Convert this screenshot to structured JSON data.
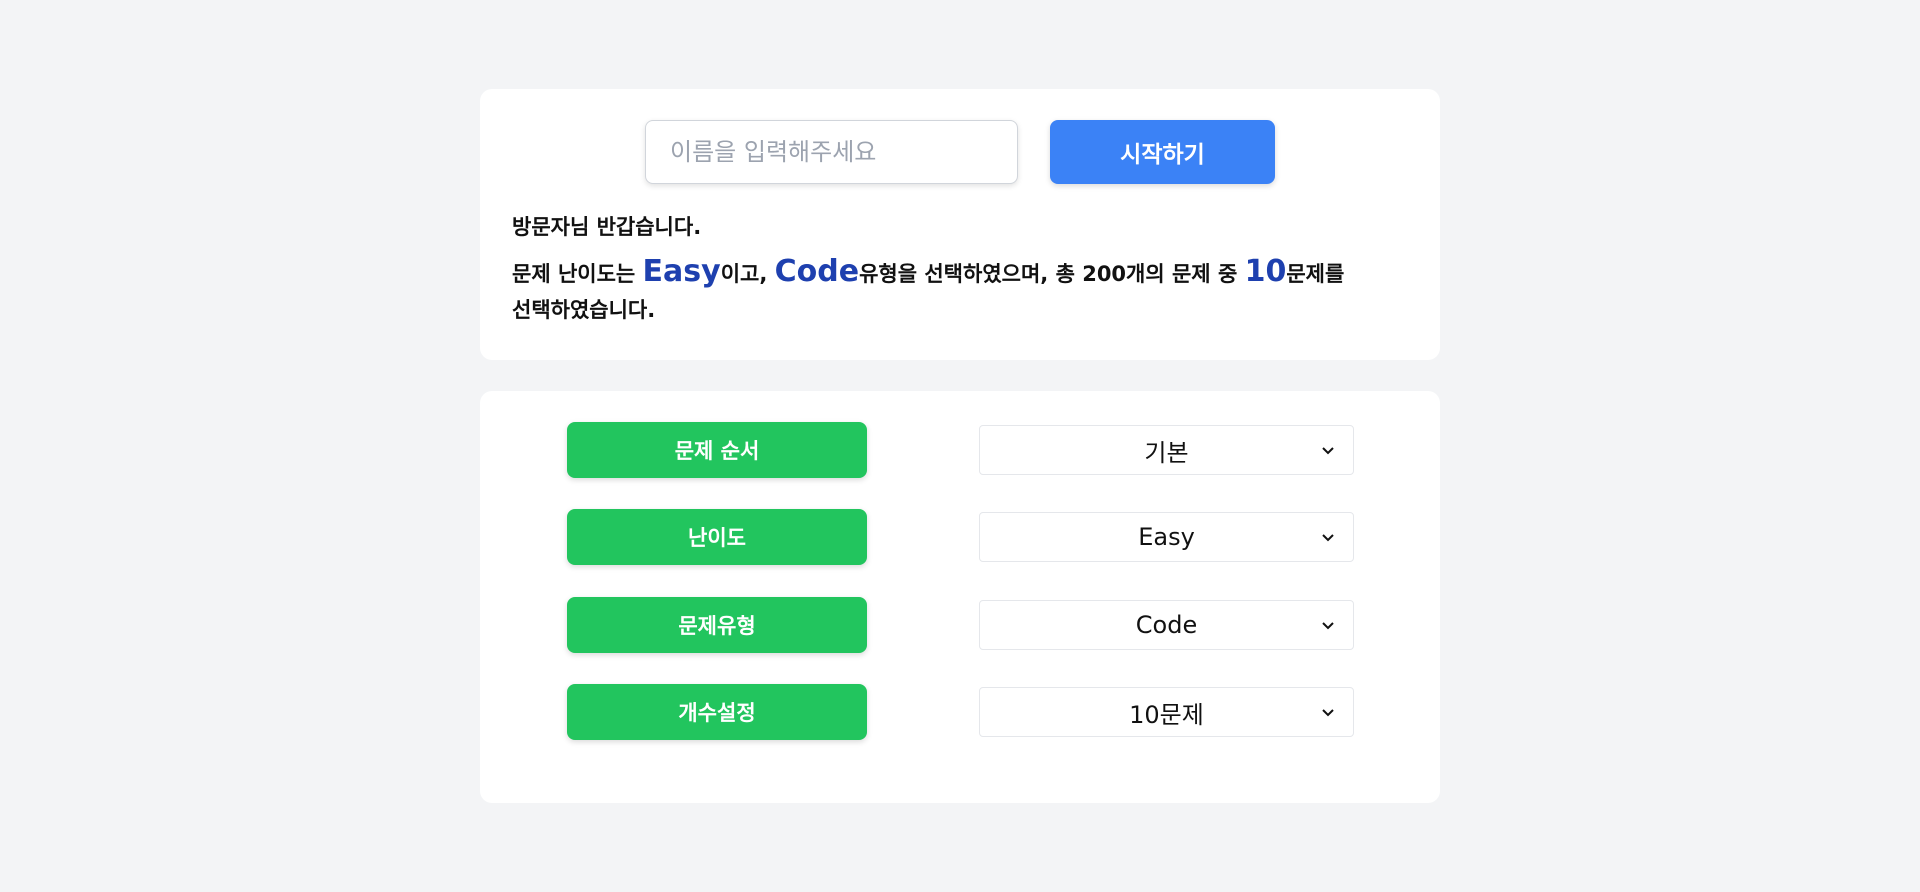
{
  "top": {
    "name_placeholder": "이름을 입력해주세요",
    "name_value": "",
    "start_button": "시작하기",
    "greeting": "방문자님 반갑습니다.",
    "summary": {
      "part1": "문제 난이도는 ",
      "difficulty": "Easy",
      "part2": "이고, ",
      "type": "Code",
      "part3": "유형을 선택하였으며, 총 200개의 문제 중 ",
      "count": "10",
      "part4": "문제를 선택하였습니다."
    }
  },
  "settings": [
    {
      "label": "문제 순서",
      "value": "기본"
    },
    {
      "label": "난이도",
      "value": "Easy"
    },
    {
      "label": "문제유형",
      "value": "Code"
    },
    {
      "label": "개수설정",
      "value": "10문제"
    }
  ],
  "colors": {
    "background": "#f3f4f6",
    "primary_button": "#3b82f6",
    "label_button": "#22c55e",
    "highlight_text": "#1e40af"
  },
  "icons": {
    "select_arrow": "chevron-down-icon"
  }
}
